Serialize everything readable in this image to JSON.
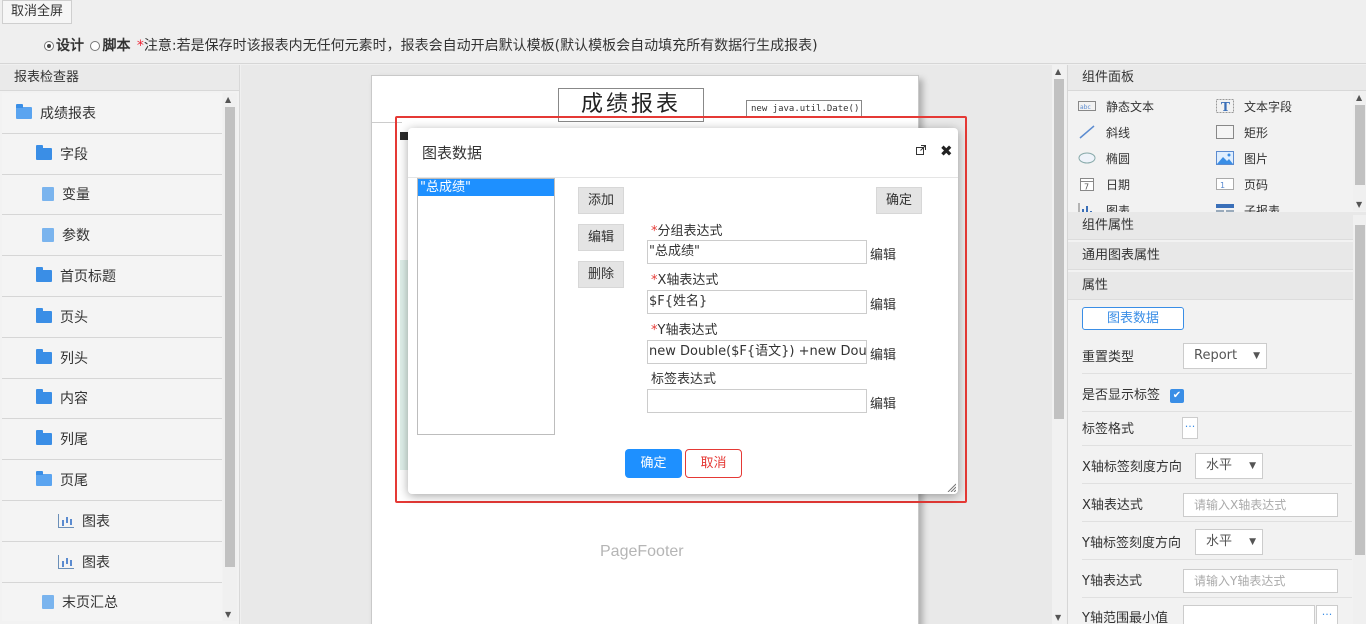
{
  "toolbar": {
    "exit_fullscreen": "取消全屏",
    "mode_design": "设计",
    "mode_script": "脚本",
    "note_star": "*",
    "note": "注意:若是保存时该报表内无任何元素时，报表会自动开启默认模板(默认模板会自动填充所有数据行生成报表)"
  },
  "left_panel": {
    "title": "报表检查器",
    "items": [
      {
        "label": "成绩报表",
        "icon": "folder-open-icon"
      },
      {
        "label": "字段",
        "icon": "folder-icon"
      },
      {
        "label": "变量",
        "icon": "file-icon"
      },
      {
        "label": "参数",
        "icon": "file-icon"
      },
      {
        "label": "首页标题",
        "icon": "folder-icon"
      },
      {
        "label": "页头",
        "icon": "folder-icon"
      },
      {
        "label": "列头",
        "icon": "folder-icon"
      },
      {
        "label": "内容",
        "icon": "folder-icon"
      },
      {
        "label": "列尾",
        "icon": "folder-icon"
      },
      {
        "label": "页尾",
        "icon": "folder-open-icon"
      },
      {
        "label": "图表",
        "icon": "chart-icon"
      },
      {
        "label": "图表",
        "icon": "chart-icon"
      },
      {
        "label": "末页汇总",
        "icon": "file-icon"
      }
    ]
  },
  "canvas": {
    "report_title": "成绩报表",
    "date_expr": "new java.util.Date()",
    "page_footer": "PageFooter"
  },
  "right_panel": {
    "components_title": "组件面板",
    "components": [
      {
        "label": "静态文本",
        "icon": "static-text-icon"
      },
      {
        "label": "文本字段",
        "icon": "text-field-icon"
      },
      {
        "label": "斜线",
        "icon": "diagonal-line-icon"
      },
      {
        "label": "矩形",
        "icon": "rectangle-icon"
      },
      {
        "label": "椭圆",
        "icon": "ellipse-icon"
      },
      {
        "label": "图片",
        "icon": "image-icon"
      },
      {
        "label": "日期",
        "icon": "date-icon"
      },
      {
        "label": "页码",
        "icon": "page-number-icon"
      },
      {
        "label": "图表",
        "icon": "chart-icon"
      },
      {
        "label": "子报表",
        "icon": "subreport-icon"
      }
    ],
    "component_props": "组件属性",
    "general_chart_props": "通用图表属性",
    "props": "属性",
    "chart_data_btn": "图表数据",
    "reset_type_label": "重置类型",
    "reset_type_value": "Report",
    "show_labels_label": "是否显示标签",
    "label_format_label": "标签格式",
    "x_tick_dir_label": "X轴标签刻度方向",
    "x_tick_dir_value": "水平",
    "x_expr_label": "X轴表达式",
    "x_expr_placeholder": "请输入X轴表达式",
    "y_tick_dir_label": "Y轴标签刻度方向",
    "y_tick_dir_value": "水平",
    "y_expr_label": "Y轴表达式",
    "y_expr_placeholder": "请输入Y轴表达式",
    "y_min_label": "Y轴范围最小值"
  },
  "dialog": {
    "title": "图表数据",
    "series": [
      "\"总成绩\""
    ],
    "add": "添加",
    "edit": "编辑",
    "delete": "删除",
    "confirm_top": "确定",
    "group_label": "分组表达式",
    "group_value": "\"总成绩\"",
    "x_label": "X轴表达式",
    "x_value": "$F{姓名}",
    "y_label": "Y轴表达式",
    "y_value": "new Double($F{语文}) +new Double($F",
    "tag_label": "标签表达式",
    "tag_value": "",
    "edit_link": "编辑",
    "ok": "确定",
    "cancel": "取消"
  }
}
